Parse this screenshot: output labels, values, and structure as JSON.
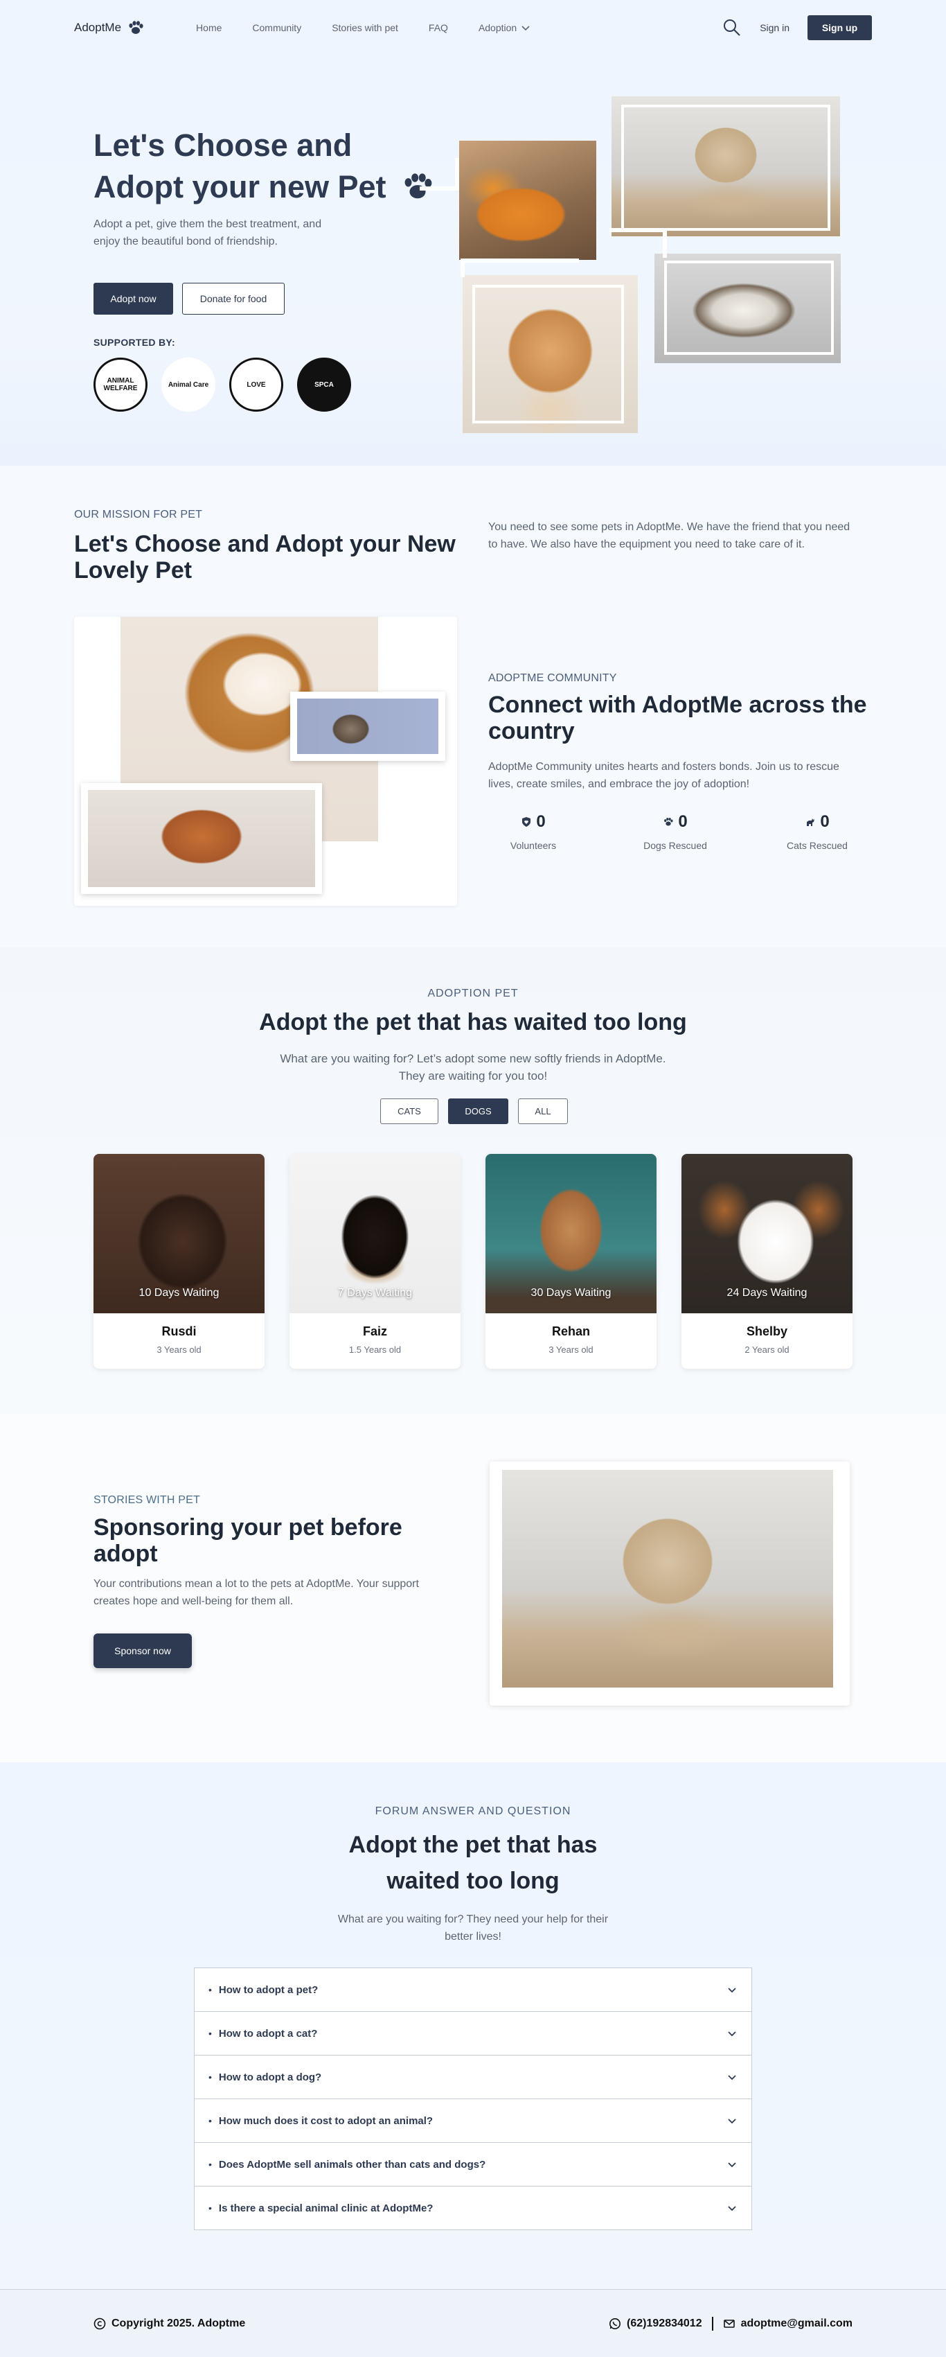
{
  "nav": {
    "brand": "AdoptMe",
    "links": [
      "Home",
      "Community",
      "Stories with pet",
      "FAQ",
      "Adoption"
    ],
    "signin": "Sign in",
    "signup": "Sign up"
  },
  "hero": {
    "title": "Let's Choose and Adopt your new Pet",
    "subtitle": "Adopt a pet, give them the best treatment, and enjoy the beautiful bond of friendship.",
    "adopt_button": "Adopt now",
    "donate_button": "Donate for food",
    "supported_label": "SUPPORTED BY:",
    "supporters": [
      "ANIMAL WELFARE",
      "Animal Care",
      "LOVE",
      "SPCA"
    ]
  },
  "mission": {
    "eyebrow": "OUR MISSION FOR PET",
    "title": "Let's Choose and Adopt your New Lovely Pet",
    "text": "You need to see some pets in AdoptMe. We have the friend that you need to have. We also have the equipment you need to take care of it."
  },
  "community": {
    "eyebrow": "ADOPTME COMMUNITY",
    "title": "Connect with AdoptMe across the country",
    "desc": "AdoptMe Community unites hearts and fosters bonds.  Join us to rescue lives, create smiles, and embrace the joy of adoption!",
    "stats": [
      {
        "value": "0",
        "label": "Volunteers",
        "icon": "shield-heart-icon"
      },
      {
        "value": "0",
        "label": "Dogs Rescued",
        "icon": "paw-icon"
      },
      {
        "value": "0",
        "label": "Cats Rescued",
        "icon": "cat-icon"
      }
    ]
  },
  "adoption": {
    "eyebrow": "ADOPTION PET",
    "title": "Adopt the pet that has waited too long",
    "sub": "What are you waiting for? Let’s adopt some new softly friends in AdoptMe. They are waiting for you too!",
    "filters": [
      "CATS",
      "DOGS",
      "ALL"
    ],
    "active_filter": "DOGS",
    "pets": [
      {
        "name": "Rusdi",
        "age": "3 Years old",
        "waiting": "10 Days Waiting"
      },
      {
        "name": "Faiz",
        "age": "1.5 Years old",
        "waiting": "7 Days Waiting"
      },
      {
        "name": "Rehan",
        "age": "3 Years old",
        "waiting": "30 Days Waiting"
      },
      {
        "name": "Shelby",
        "age": "2 Years old",
        "waiting": "24 Days Waiting"
      }
    ]
  },
  "stories": {
    "eyebrow": "STORIES WITH PET",
    "title": "Sponsoring your pet before adopt",
    "desc": "Your contributions mean a lot to the pets at AdoptMe. Your support creates hope and well-being for them all.",
    "button": "Sponsor now"
  },
  "faq": {
    "eyebrow": "FORUM ANSWER AND QUESTION",
    "title_line1": "Adopt the pet that has",
    "title_line2": "waited too long",
    "sub": "What are you waiting for? They need your help for their better lives!",
    "items": [
      "How to adopt a pet?",
      "How to adopt a cat?",
      "How to adopt a dog?",
      "How much does it cost to adopt an animal?",
      "Does AdoptMe sell animals other than cats and dogs?",
      "Is there a special animal clinic at AdoptMe?"
    ]
  },
  "footer": {
    "copyright": "Copyright 2025. Adoptme",
    "phone": "(62)192834012",
    "email": "adoptme@gmail.com"
  },
  "colors": {
    "primary": "#2d3a52",
    "muted": "#5b6472",
    "background": "#f4f8fd"
  }
}
